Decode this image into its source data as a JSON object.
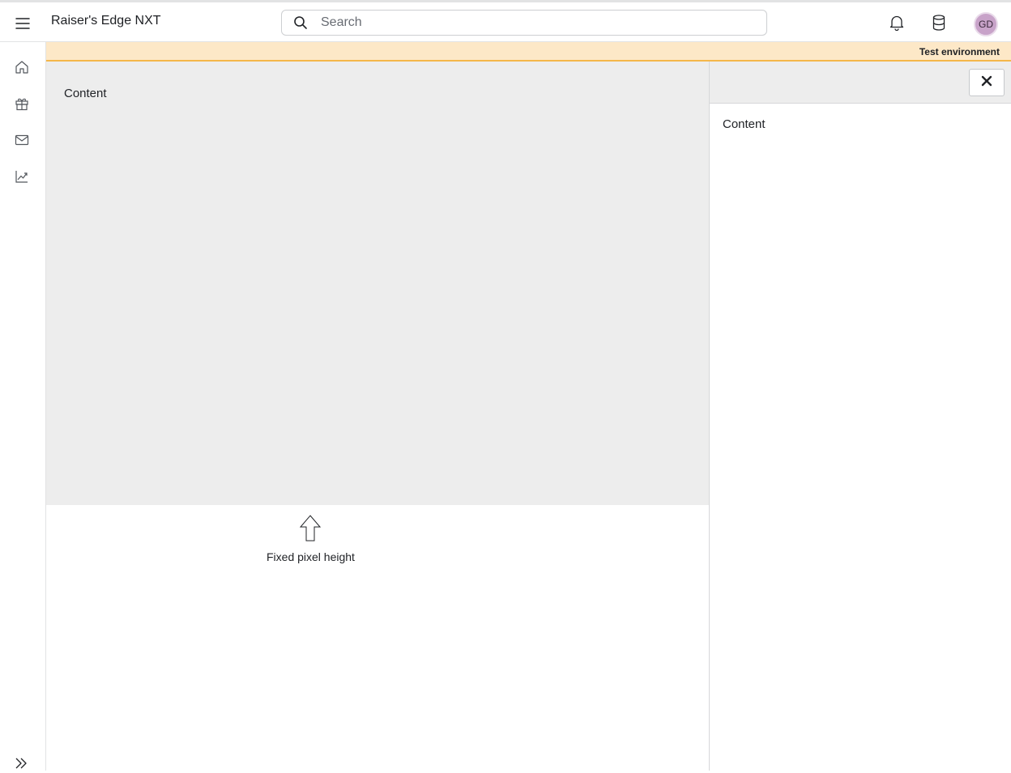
{
  "header": {
    "app_title": "Raiser's Edge NXT",
    "search_placeholder": "Search",
    "avatar_initials": "GD",
    "icons": [
      "menu-icon",
      "search-icon",
      "bell-icon",
      "database-icon"
    ]
  },
  "leftnav": {
    "items": [
      {
        "icon": "home-icon"
      },
      {
        "icon": "gift-icon"
      },
      {
        "icon": "mail-icon"
      },
      {
        "icon": "analytics-icon"
      }
    ],
    "expand_icon": "double-chevron-right-icon"
  },
  "banner": {
    "text": "Test environment",
    "color": "#fde8c7",
    "border_color": "#f5b74a"
  },
  "main": {
    "content_label": "Content",
    "background": "#ededed"
  },
  "flyout": {
    "content_label": "Content",
    "close_icon": "close-icon"
  },
  "annotation": {
    "text": "Fixed pixel height",
    "icon": "arrow-up-icon"
  }
}
